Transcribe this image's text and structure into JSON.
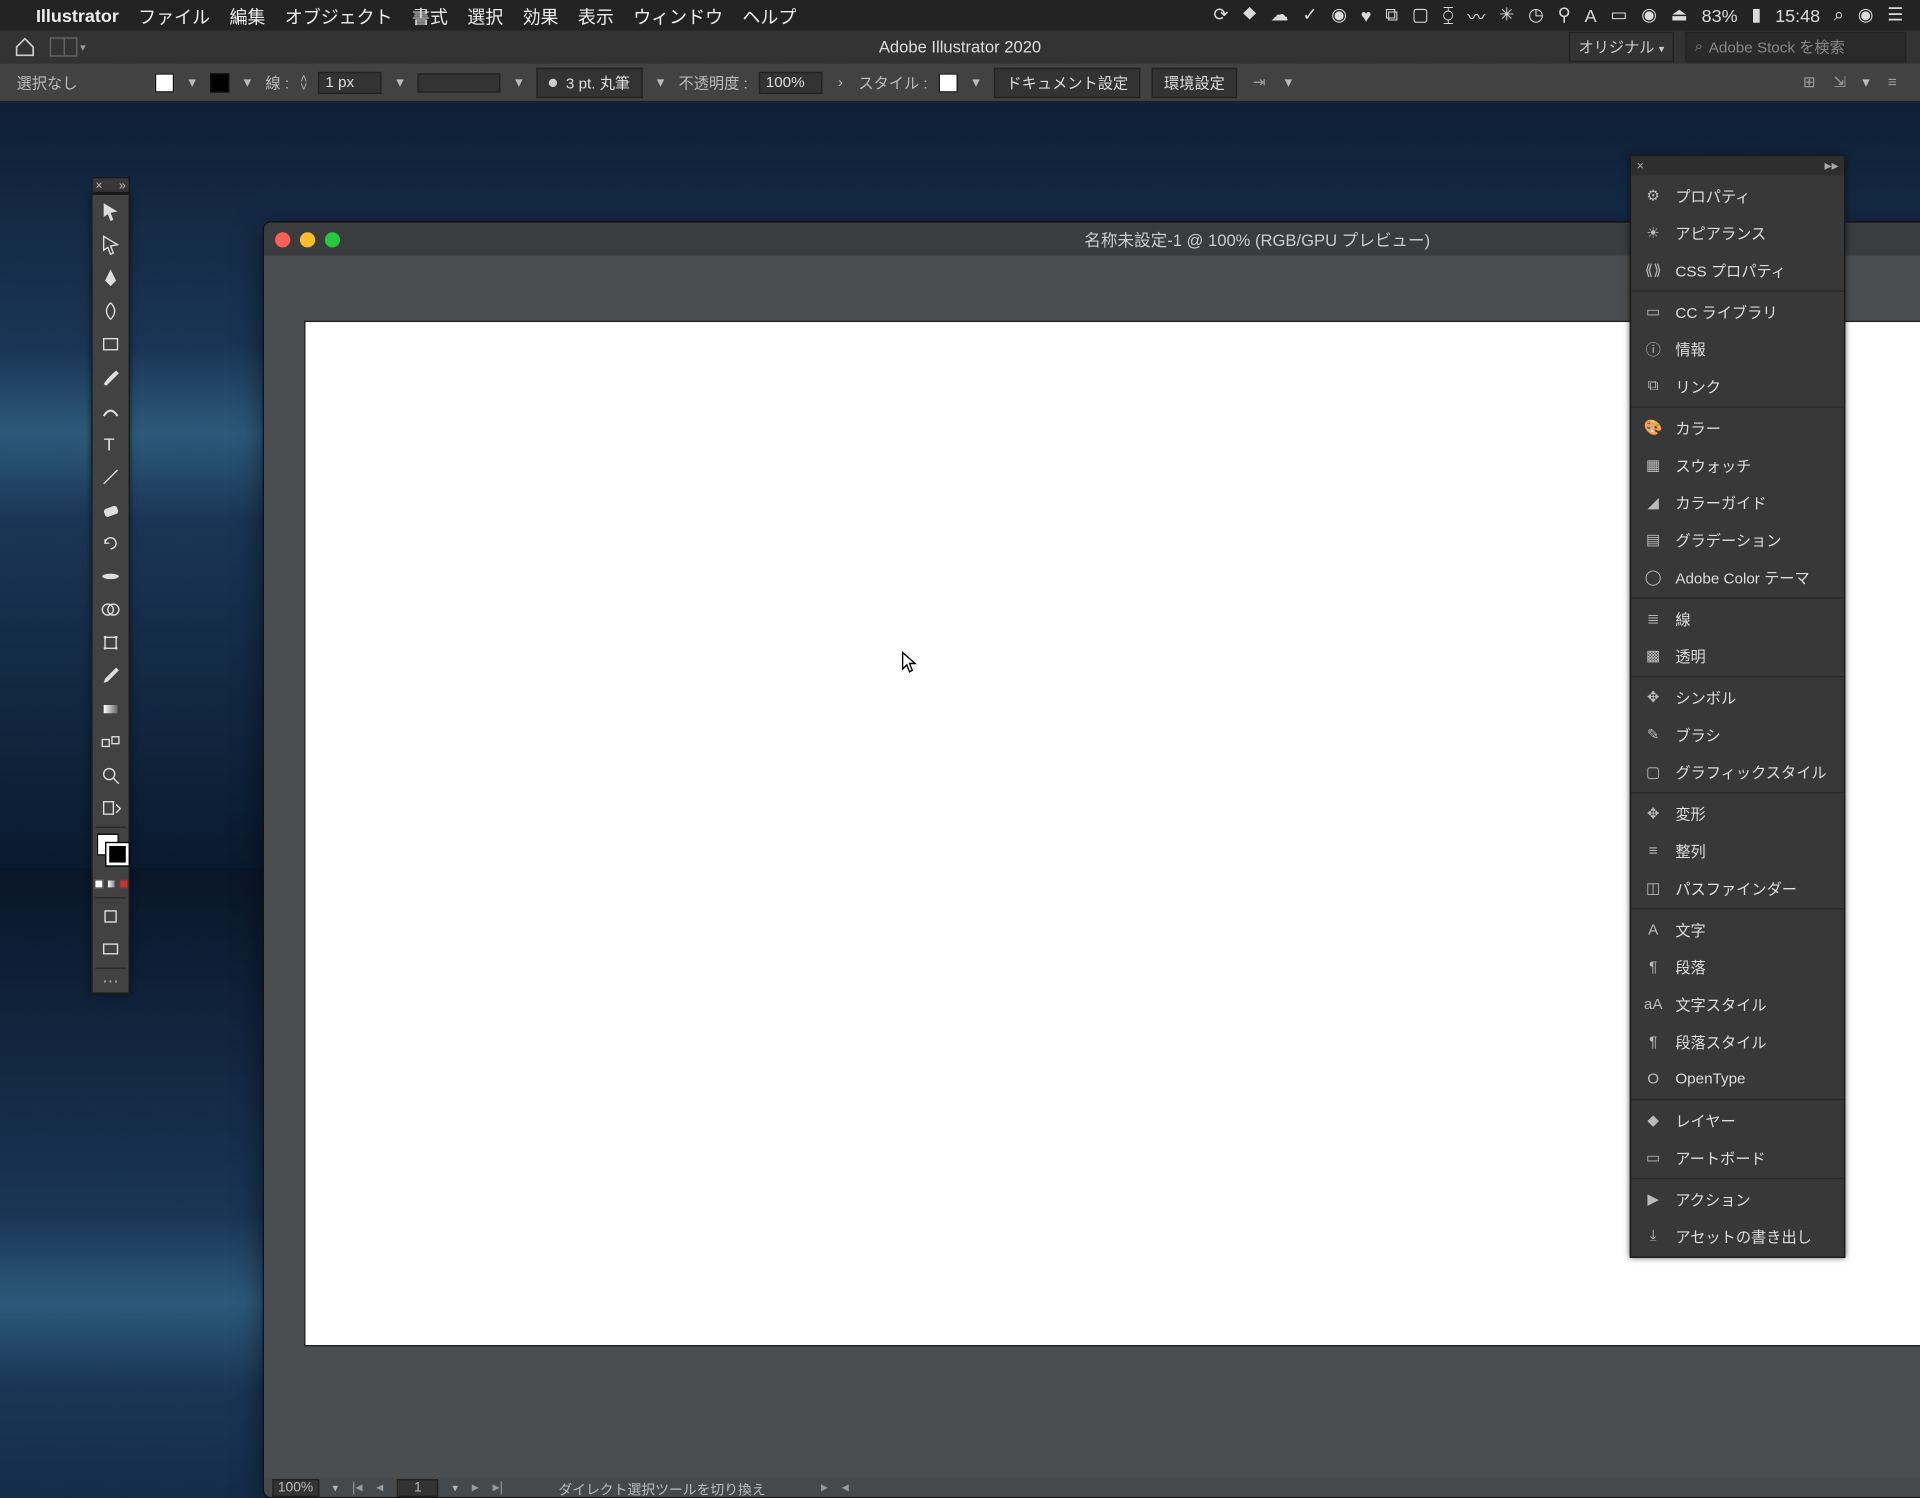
{
  "menubar": {
    "app": "Illustrator",
    "items": [
      "ファイル",
      "編集",
      "オブジェクト",
      "書式",
      "選択",
      "効果",
      "表示",
      "ウィンドウ",
      "ヘルプ"
    ],
    "right": {
      "battery": "83%",
      "time": "15:48"
    }
  },
  "dockbar": {
    "app_title": "Adobe Illustrator 2020",
    "workspace": "オリジナル",
    "search_placeholder": "Adobe Stock を検索"
  },
  "controlbar": {
    "selection": "選択なし",
    "stroke_label": "線 :",
    "stroke_width": "1 px",
    "brush": "3 pt. 丸筆",
    "opacity_label": "不透明度 :",
    "opacity_value": "100%",
    "style_label": "スタイル :",
    "doc_setup": "ドキュメント設定",
    "prefs": "環境設定"
  },
  "document": {
    "title": "名称未設定-1 @ 100% (RGB/GPU プレビュー)",
    "status_zoom": "100%",
    "status_artboard": "1",
    "status_tool": "ダイレクト選択ツールを切り換え"
  },
  "tools": [
    "selection",
    "direct-selection",
    "pen",
    "curvature",
    "rectangle",
    "paintbrush",
    "shaper",
    "eraser",
    "type",
    "line",
    "rotate",
    "scale",
    "width",
    "free-transform",
    "shape-builder",
    "perspective",
    "mesh",
    "gradient",
    "eyedropper",
    "blend",
    "symbol-sprayer",
    "column-graph",
    "slice",
    "zoom",
    "hand"
  ],
  "right_panels": [
    {
      "group": 1,
      "items": [
        {
          "name": "properties",
          "label": "プロパティ",
          "icon": "sliders"
        },
        {
          "name": "appearance",
          "label": "アピアランス",
          "icon": "sun"
        },
        {
          "name": "css-properties",
          "label": "CSS プロパティ",
          "icon": "css"
        }
      ]
    },
    {
      "group": 2,
      "items": [
        {
          "name": "cc-libraries",
          "label": "CC ライブラリ",
          "icon": "book"
        },
        {
          "name": "info",
          "label": "情報",
          "icon": "info"
        },
        {
          "name": "links",
          "label": "リンク",
          "icon": "link"
        }
      ]
    },
    {
      "group": 3,
      "items": [
        {
          "name": "color",
          "label": "カラー",
          "icon": "palette"
        },
        {
          "name": "swatches",
          "label": "スウォッチ",
          "icon": "grid"
        },
        {
          "name": "color-guide",
          "label": "カラーガイド",
          "icon": "fan"
        },
        {
          "name": "gradient",
          "label": "グラデーション",
          "icon": "gradient"
        },
        {
          "name": "adobe-color",
          "label": "Adobe Color テーマ",
          "icon": "wheel"
        }
      ]
    },
    {
      "group": 4,
      "items": [
        {
          "name": "stroke",
          "label": "線",
          "icon": "lines"
        },
        {
          "name": "transparency",
          "label": "透明",
          "icon": "checker"
        }
      ]
    },
    {
      "group": 5,
      "items": [
        {
          "name": "symbols",
          "label": "シンボル",
          "icon": "clover"
        },
        {
          "name": "brushes",
          "label": "ブラシ",
          "icon": "brush"
        },
        {
          "name": "graphic-styles",
          "label": "グラフィックスタイル",
          "icon": "square"
        }
      ]
    },
    {
      "group": 6,
      "items": [
        {
          "name": "transform",
          "label": "変形",
          "icon": "move"
        },
        {
          "name": "align",
          "label": "整列",
          "icon": "align"
        },
        {
          "name": "pathfinder",
          "label": "パスファインダー",
          "icon": "pathfinder"
        }
      ]
    },
    {
      "group": 7,
      "items": [
        {
          "name": "character",
          "label": "文字",
          "icon": "A"
        },
        {
          "name": "paragraph",
          "label": "段落",
          "icon": "para"
        },
        {
          "name": "char-styles",
          "label": "文字スタイル",
          "icon": "Aa"
        },
        {
          "name": "para-styles",
          "label": "段落スタイル",
          "icon": "paraS"
        },
        {
          "name": "opentype",
          "label": "OpenType",
          "icon": "O"
        }
      ]
    },
    {
      "group": 8,
      "items": [
        {
          "name": "layers",
          "label": "レイヤー",
          "icon": "layers"
        },
        {
          "name": "artboards",
          "label": "アートボード",
          "icon": "artboard"
        }
      ]
    },
    {
      "group": 9,
      "items": [
        {
          "name": "actions",
          "label": "アクション",
          "icon": "play"
        },
        {
          "name": "asset-export",
          "label": "アセットの書き出し",
          "icon": "export"
        }
      ]
    }
  ]
}
